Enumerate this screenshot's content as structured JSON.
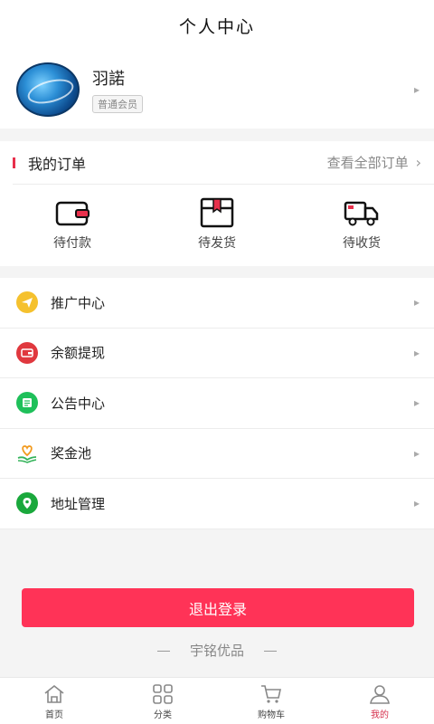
{
  "header": {
    "title": "个人中心"
  },
  "profile": {
    "username": "羽諾",
    "member_level": "普通会员"
  },
  "orders": {
    "title": "我的订单",
    "view_all": "查看全部订单",
    "items": [
      {
        "label": "待付款",
        "icon": "wallet-icon"
      },
      {
        "label": "待发货",
        "icon": "package-icon"
      },
      {
        "label": "待收货",
        "icon": "truck-icon"
      }
    ]
  },
  "menu": {
    "items": [
      {
        "label": "推广中心",
        "icon": "paper-plane-icon",
        "color": "#f5c12e"
      },
      {
        "label": "余额提现",
        "icon": "wallet-icon",
        "color": "#e0383e"
      },
      {
        "label": "公告中心",
        "icon": "notice-icon",
        "color": "#1fc05a"
      },
      {
        "label": "奖金池",
        "icon": "heart-hand-icon",
        "color": "#f29a1e"
      },
      {
        "label": "地址管理",
        "icon": "location-pin-icon",
        "color": "#1aa83c"
      }
    ]
  },
  "logout": {
    "label": "退出登录"
  },
  "brand": {
    "name": "宇铭优品"
  },
  "tabbar": {
    "items": [
      {
        "label": "首页",
        "icon": "home-icon"
      },
      {
        "label": "分类",
        "icon": "grid-icon"
      },
      {
        "label": "购物车",
        "icon": "cart-icon"
      },
      {
        "label": "我的",
        "icon": "user-icon",
        "active": true
      }
    ]
  },
  "colors": {
    "accent": "#ff3357",
    "active_tab": "#d6304c"
  }
}
